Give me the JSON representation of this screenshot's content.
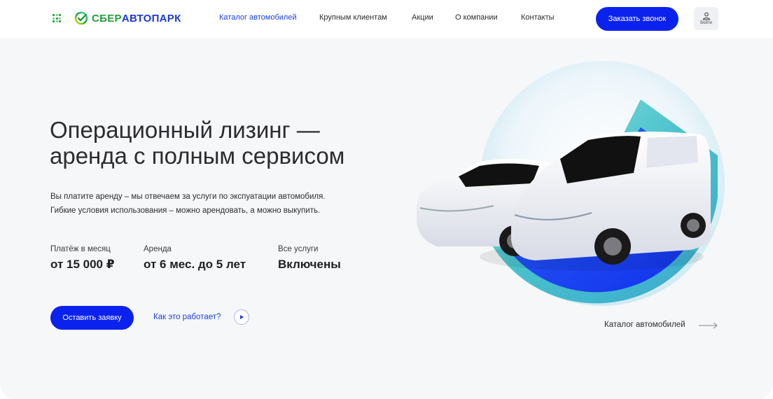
{
  "header": {
    "brand_sber": "СБЕР",
    "brand_auto": "АВТОПАРК",
    "nav": [
      {
        "label": "Каталог автомобилей",
        "active": true
      },
      {
        "label": "Крупным клиентам",
        "active": false
      },
      {
        "label": "Акции",
        "active": false
      },
      {
        "label": "О компании",
        "active": false
      },
      {
        "label": "Контакты",
        "active": false
      }
    ],
    "call_button": "Заказать звонок",
    "login_label": "Войти",
    "icons": {
      "apps": "apps-grid-icon",
      "logo": "sber-logo-icon",
      "user": "user-icon"
    }
  },
  "hero": {
    "title_line1": "Операционный лизинг —",
    "title_line2": "аренда с полным сервисом",
    "desc_line1": "Вы платите аренду – мы отвечаем за услуги по экспуатации автомобиля.",
    "desc_line2": "Гибкие условия использования – можно арендовать, а можно выкупить.",
    "stats": [
      {
        "label": "Платёж в месяц",
        "value": "от 15 000 ₽"
      },
      {
        "label": "Аренда",
        "value": "от 6 мес. до 5 лет"
      },
      {
        "label": "Все услуги",
        "value": "Включены"
      }
    ],
    "apply_button": "Оставить заявку",
    "how_link": "Как это работает?",
    "catalog_link": "Каталог автомобилей"
  },
  "colors": {
    "accent_blue": "#0b22ee",
    "link_blue": "#1a3fe0",
    "brand_green": "#21a038",
    "background": "#f6f7f9"
  }
}
